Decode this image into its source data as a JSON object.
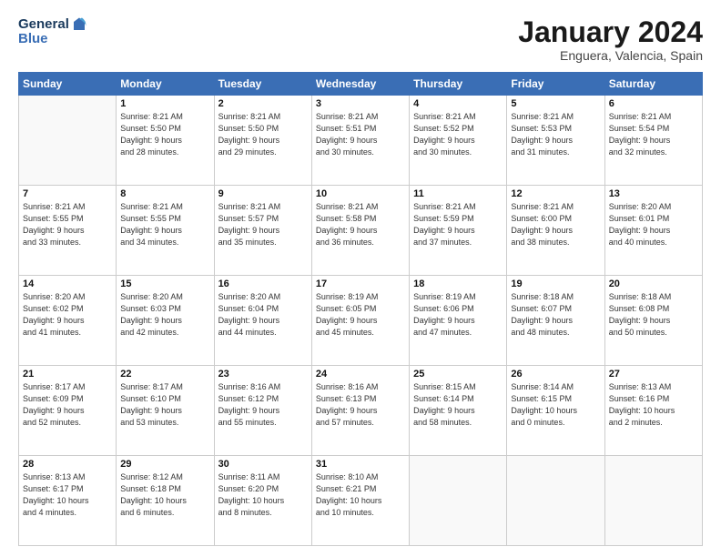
{
  "logo": {
    "line1": "General",
    "line2": "Blue"
  },
  "title": "January 2024",
  "subtitle": "Enguera, Valencia, Spain",
  "days_header": [
    "Sunday",
    "Monday",
    "Tuesday",
    "Wednesday",
    "Thursday",
    "Friday",
    "Saturday"
  ],
  "weeks": [
    [
      {
        "day": "",
        "info": ""
      },
      {
        "day": "1",
        "info": "Sunrise: 8:21 AM\nSunset: 5:50 PM\nDaylight: 9 hours\nand 28 minutes."
      },
      {
        "day": "2",
        "info": "Sunrise: 8:21 AM\nSunset: 5:50 PM\nDaylight: 9 hours\nand 29 minutes."
      },
      {
        "day": "3",
        "info": "Sunrise: 8:21 AM\nSunset: 5:51 PM\nDaylight: 9 hours\nand 30 minutes."
      },
      {
        "day": "4",
        "info": "Sunrise: 8:21 AM\nSunset: 5:52 PM\nDaylight: 9 hours\nand 30 minutes."
      },
      {
        "day": "5",
        "info": "Sunrise: 8:21 AM\nSunset: 5:53 PM\nDaylight: 9 hours\nand 31 minutes."
      },
      {
        "day": "6",
        "info": "Sunrise: 8:21 AM\nSunset: 5:54 PM\nDaylight: 9 hours\nand 32 minutes."
      }
    ],
    [
      {
        "day": "7",
        "info": ""
      },
      {
        "day": "8",
        "info": "Sunrise: 8:21 AM\nSunset: 5:55 PM\nDaylight: 9 hours\nand 34 minutes."
      },
      {
        "day": "9",
        "info": "Sunrise: 8:21 AM\nSunset: 5:57 PM\nDaylight: 9 hours\nand 35 minutes."
      },
      {
        "day": "10",
        "info": "Sunrise: 8:21 AM\nSunset: 5:58 PM\nDaylight: 9 hours\nand 36 minutes."
      },
      {
        "day": "11",
        "info": "Sunrise: 8:21 AM\nSunset: 5:59 PM\nDaylight: 9 hours\nand 37 minutes."
      },
      {
        "day": "12",
        "info": "Sunrise: 8:21 AM\nSunset: 6:00 PM\nDaylight: 9 hours\nand 38 minutes."
      },
      {
        "day": "13",
        "info": "Sunrise: 8:20 AM\nSunset: 6:01 PM\nDaylight: 9 hours\nand 40 minutes."
      }
    ],
    [
      {
        "day": "14",
        "info": ""
      },
      {
        "day": "15",
        "info": "Sunrise: 8:20 AM\nSunset: 6:03 PM\nDaylight: 9 hours\nand 42 minutes."
      },
      {
        "day": "16",
        "info": "Sunrise: 8:20 AM\nSunset: 6:04 PM\nDaylight: 9 hours\nand 44 minutes."
      },
      {
        "day": "17",
        "info": "Sunrise: 8:19 AM\nSunset: 6:05 PM\nDaylight: 9 hours\nand 45 minutes."
      },
      {
        "day": "18",
        "info": "Sunrise: 8:19 AM\nSunset: 6:06 PM\nDaylight: 9 hours\nand 47 minutes."
      },
      {
        "day": "19",
        "info": "Sunrise: 8:18 AM\nSunset: 6:07 PM\nDaylight: 9 hours\nand 48 minutes."
      },
      {
        "day": "20",
        "info": "Sunrise: 8:18 AM\nSunset: 6:08 PM\nDaylight: 9 hours\nand 50 minutes."
      }
    ],
    [
      {
        "day": "21",
        "info": ""
      },
      {
        "day": "22",
        "info": "Sunrise: 8:17 AM\nSunset: 6:10 PM\nDaylight: 9 hours\nand 53 minutes."
      },
      {
        "day": "23",
        "info": "Sunrise: 8:16 AM\nSunset: 6:12 PM\nDaylight: 9 hours\nand 55 minutes."
      },
      {
        "day": "24",
        "info": "Sunrise: 8:16 AM\nSunset: 6:13 PM\nDaylight: 9 hours\nand 57 minutes."
      },
      {
        "day": "25",
        "info": "Sunrise: 8:15 AM\nSunset: 6:14 PM\nDaylight: 9 hours\nand 58 minutes."
      },
      {
        "day": "26",
        "info": "Sunrise: 8:14 AM\nSunset: 6:15 PM\nDaylight: 10 hours\nand 0 minutes."
      },
      {
        "day": "27",
        "info": "Sunrise: 8:13 AM\nSunset: 6:16 PM\nDaylight: 10 hours\nand 2 minutes."
      }
    ],
    [
      {
        "day": "28",
        "info": "Sunrise: 8:13 AM\nSunset: 6:17 PM\nDaylight: 10 hours\nand 4 minutes."
      },
      {
        "day": "29",
        "info": "Sunrise: 8:12 AM\nSunset: 6:18 PM\nDaylight: 10 hours\nand 6 minutes."
      },
      {
        "day": "30",
        "info": "Sunrise: 8:11 AM\nSunset: 6:20 PM\nDaylight: 10 hours\nand 8 minutes."
      },
      {
        "day": "31",
        "info": "Sunrise: 8:10 AM\nSunset: 6:21 PM\nDaylight: 10 hours\nand 10 minutes."
      },
      {
        "day": "",
        "info": ""
      },
      {
        "day": "",
        "info": ""
      },
      {
        "day": "",
        "info": ""
      }
    ]
  ],
  "week1_sun_info": "Sunrise: 8:21 AM\nSunset: 5:55 PM\nDaylight: 9 hours\nand 33 minutes.",
  "week3_sun_info": "Sunrise: 8:20 AM\nSunset: 6:02 PM\nDaylight: 9 hours\nand 41 minutes.",
  "week4_sun_info": "Sunrise: 8:17 AM\nSunset: 6:09 PM\nDaylight: 9 hours\nand 52 minutes."
}
